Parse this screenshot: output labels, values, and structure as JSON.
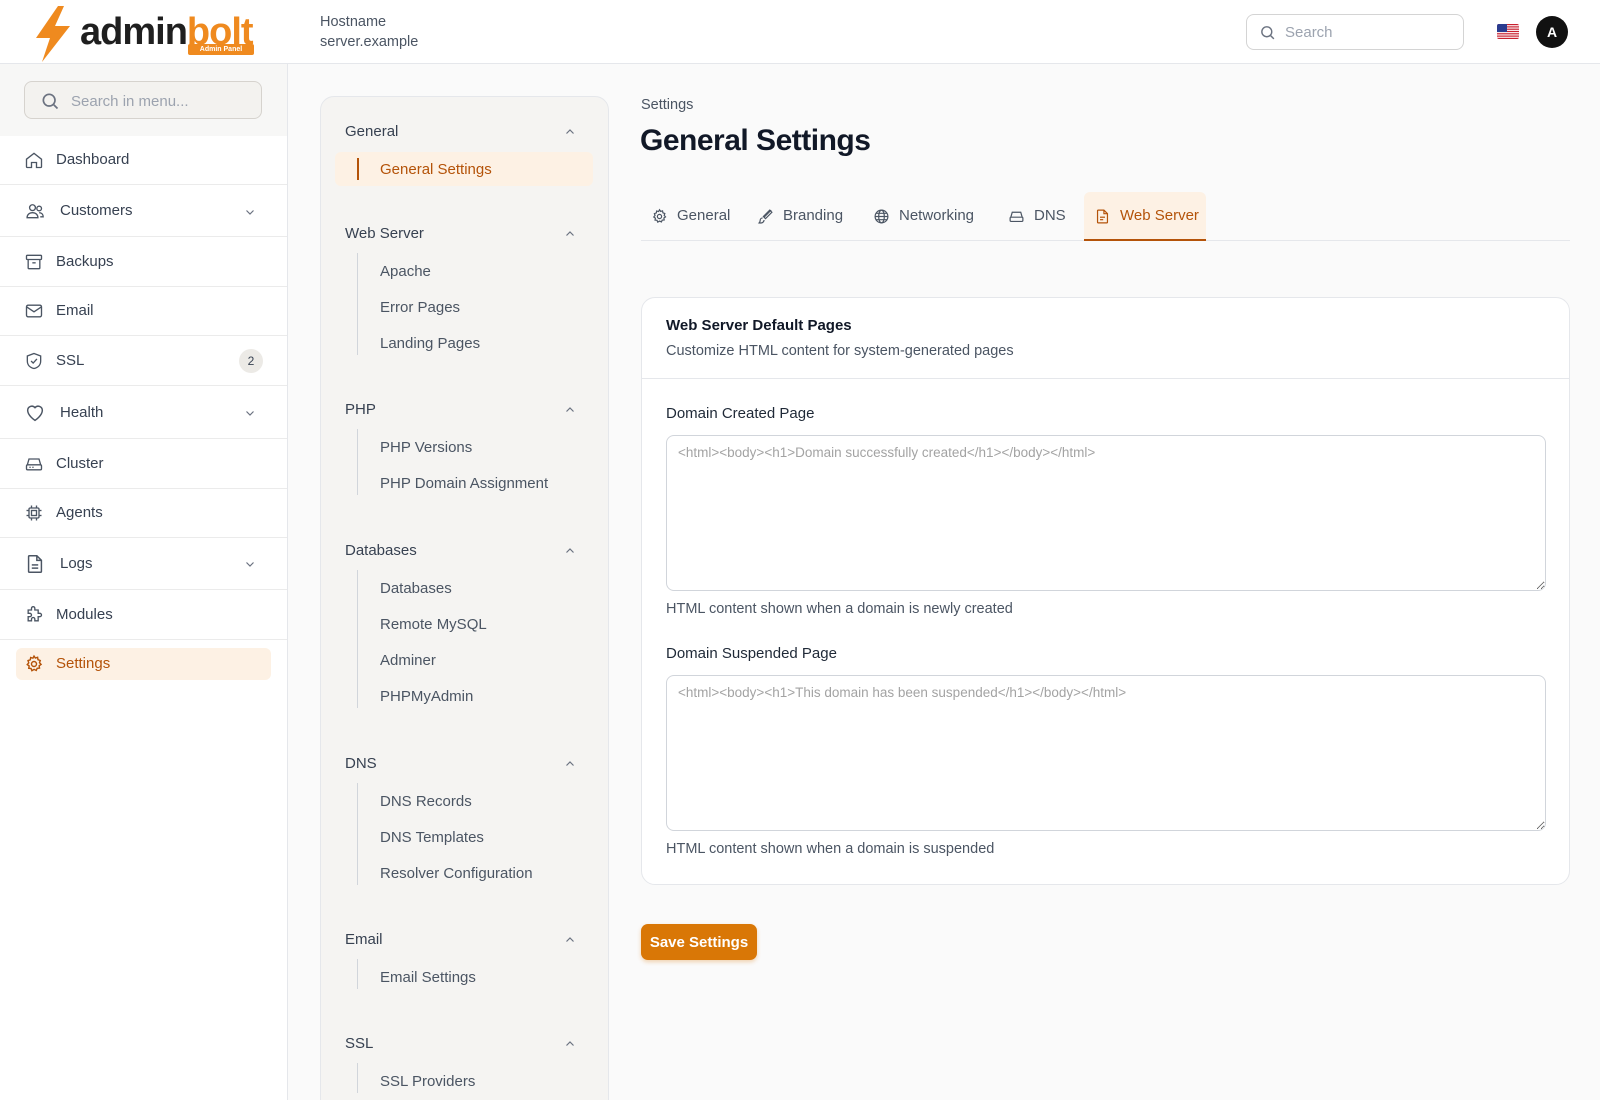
{
  "brand": {
    "name_part1": "admin",
    "name_part2": "bolt",
    "badge": "Admin Panel",
    "accent": "#ef8a1f"
  },
  "header": {
    "hostname_label": "Hostname",
    "hostname_value": "server.example",
    "search_placeholder": "Search",
    "avatar_initial": "A"
  },
  "sidebar": {
    "search_placeholder": "Search in menu...",
    "items": [
      {
        "label": "Dashboard",
        "icon": "home-icon"
      },
      {
        "label": "Customers",
        "icon": "users-icon",
        "expandable": true
      },
      {
        "label": "Backups",
        "icon": "archive-icon"
      },
      {
        "label": "Email",
        "icon": "mail-icon"
      },
      {
        "label": "SSL",
        "icon": "shield-check-icon",
        "badge": "2"
      },
      {
        "label": "Health",
        "icon": "heart-icon",
        "expandable": true
      },
      {
        "label": "Cluster",
        "icon": "server-icon"
      },
      {
        "label": "Agents",
        "icon": "cpu-icon"
      },
      {
        "label": "Logs",
        "icon": "file-text-icon",
        "expandable": true
      },
      {
        "label": "Modules",
        "icon": "puzzle-icon"
      },
      {
        "label": "Settings",
        "icon": "gear-icon",
        "active": true
      }
    ]
  },
  "subnav": {
    "groups": [
      {
        "title": "General",
        "items": [
          "General Settings"
        ]
      },
      {
        "title": "Web Server",
        "items": [
          "Apache",
          "Error Pages",
          "Landing Pages"
        ]
      },
      {
        "title": "PHP",
        "items": [
          "PHP Versions",
          "PHP Domain Assignment"
        ]
      },
      {
        "title": "Databases",
        "items": [
          "Databases",
          "Remote MySQL",
          "Adminer",
          "PHPMyAdmin"
        ]
      },
      {
        "title": "DNS",
        "items": [
          "DNS Records",
          "DNS Templates",
          "Resolver Configuration"
        ]
      },
      {
        "title": "Email",
        "items": [
          "Email Settings"
        ]
      },
      {
        "title": "SSL",
        "items": [
          "SSL Providers"
        ]
      }
    ],
    "active_item": "General Settings"
  },
  "main": {
    "breadcrumb": "Settings",
    "title": "General Settings",
    "tabs": [
      {
        "label": "General",
        "icon": "gear-icon"
      },
      {
        "label": "Branding",
        "icon": "brush-icon"
      },
      {
        "label": "Networking",
        "icon": "globe-icon"
      },
      {
        "label": "DNS",
        "icon": "hard-drive-icon"
      },
      {
        "label": "Web Server",
        "icon": "file-icon",
        "active": true
      }
    ],
    "card": {
      "title": "Web Server Default Pages",
      "description": "Customize HTML content for system-generated pages",
      "fields": [
        {
          "label": "Domain Created Page",
          "placeholder": "<html><body><h1>Domain successfully created</h1></body></html>",
          "value": "",
          "help": "HTML content shown when a domain is newly created"
        },
        {
          "label": "Domain Suspended Page",
          "placeholder": "<html><body><h1>This domain has been suspended</h1></body></html>",
          "value": "",
          "help": "HTML content shown when a domain is suspended"
        }
      ]
    },
    "save_label": "Save Settings"
  }
}
